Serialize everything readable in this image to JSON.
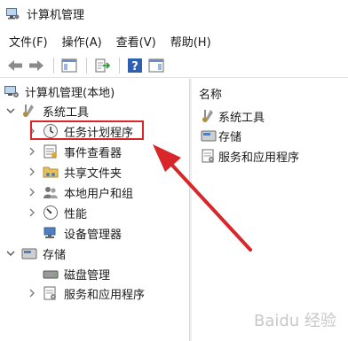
{
  "window": {
    "title": "计算机管理"
  },
  "menu": {
    "items": [
      "文件(F)",
      "操作(A)",
      "查看(V)",
      "帮助(H)"
    ]
  },
  "tree": {
    "root": "计算机管理(本地)",
    "system_tools": "系统工具",
    "task_scheduler": "任务计划程序",
    "event_viewer": "事件查看器",
    "shared_folders": "共享文件夹",
    "local_users": "本地用户和组",
    "performance": "性能",
    "device_manager": "设备管理器",
    "storage": "存储",
    "disk_management": "磁盘管理",
    "services_apps": "服务和应用程序"
  },
  "right_pane": {
    "header": "名称",
    "items": [
      "系统工具",
      "存储",
      "服务和应用程序"
    ]
  },
  "watermark": "Baidu 经验",
  "colors": {
    "highlight": "#d9262b",
    "arrow": "#d9262b"
  }
}
